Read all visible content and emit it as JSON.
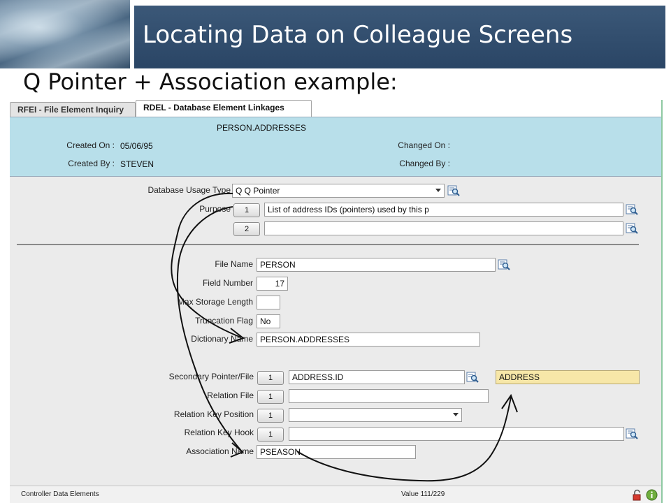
{
  "slide": {
    "title": "Locating Data on Colleague Screens",
    "subtitle": "Q Pointer + Association example:"
  },
  "tabs": [
    {
      "label": "RFEI - File Element Inquiry",
      "active": false
    },
    {
      "label": "RDEL - Database Element Linkages",
      "active": true
    }
  ],
  "header": {
    "element_name": "PERSON.ADDRESSES",
    "created_on_label": "Created On :",
    "created_on_value": "05/06/95",
    "created_by_label": "Created By :",
    "created_by_value": "STEVEN",
    "changed_on_label": "Changed On :",
    "changed_on_value": "",
    "changed_by_label": "Changed By :",
    "changed_by_value": ""
  },
  "form": {
    "usage_type_label": "Database Usage Type",
    "usage_type_value": "Q Q Pointer",
    "purpose_label": "Purpose",
    "purpose_lines": [
      {
        "num": "1",
        "text": "List of address IDs (pointers) used by this p"
      },
      {
        "num": "2",
        "text": ""
      }
    ],
    "file_name_label": "File Name",
    "file_name_value": "PERSON",
    "field_number_label": "Field Number",
    "field_number_value": "17",
    "max_storage_label": "Max Storage Length",
    "max_storage_value": "",
    "truncation_label": "Truncation Flag",
    "truncation_value": "No",
    "dictionary_label": "Dictionary Name",
    "dictionary_value": "PERSON.ADDRESSES",
    "secondary_label": "Secondary Pointer/File",
    "secondary_num": "1",
    "secondary_value": "ADDRESS.ID",
    "secondary_desc": "ADDRESS",
    "relation_file_label": "Relation File",
    "relation_file_num": "1",
    "relation_file_value": "",
    "relation_key_pos_label": "Relation Key Position",
    "relation_key_pos_num": "1",
    "relation_key_pos_value": "",
    "relation_key_hook_label": "Relation Key Hook",
    "relation_key_hook_num": "1",
    "relation_key_hook_value": "",
    "association_label": "Association Name",
    "association_value": "PSEASON"
  },
  "status": {
    "left": "Controller Data Elements",
    "center": "Value 111/229",
    "icons": [
      "lock-icon",
      "info-icon"
    ]
  },
  "colors": {
    "header_bar": "#2f4b6b",
    "info_panel": "#b8dfea",
    "form_panel": "#ebebeb",
    "highlight_field": "#f7e7a8"
  }
}
